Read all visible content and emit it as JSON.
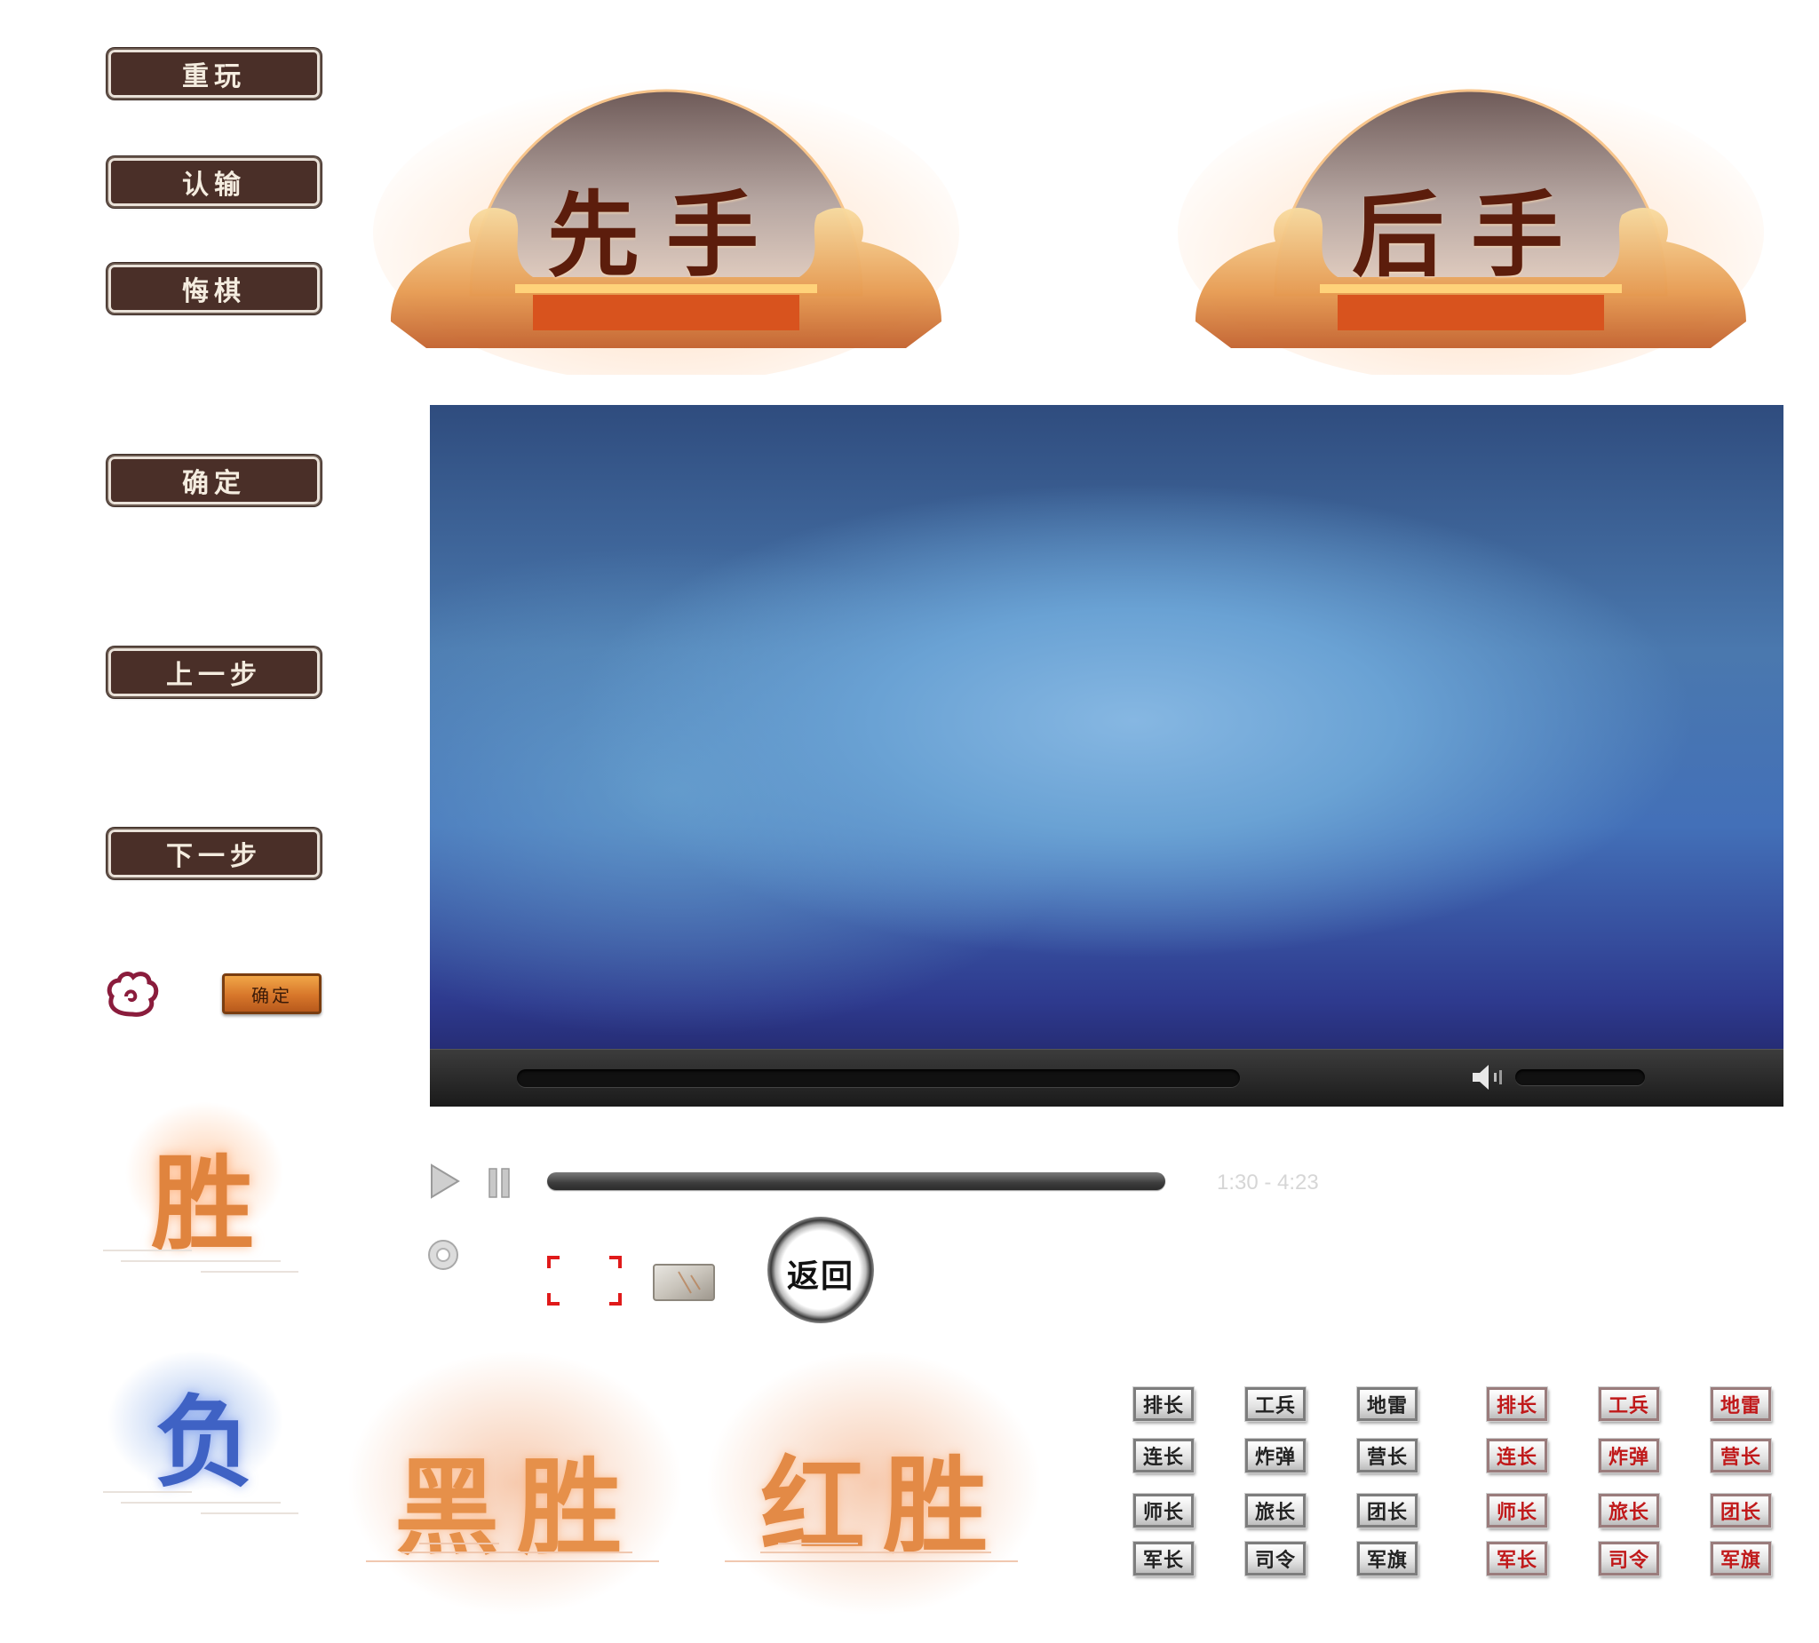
{
  "menu": {
    "replay": "重玩",
    "surrender": "认输",
    "undo": "悔棋",
    "confirm": "确定",
    "prev_step": "上一步",
    "next_step": "下一步"
  },
  "wood_confirm": "确定",
  "plaques": {
    "first": "先手",
    "second": "后手"
  },
  "player": {
    "timecode": "1:30 - 4:23",
    "progress": 1.0
  },
  "return_seal": "返回",
  "results": {
    "win": "胜",
    "lose": "负",
    "black_win": "黑胜",
    "red_win": "红胜"
  },
  "pieces": {
    "rows": [
      [
        "排长",
        "工兵",
        "地雷"
      ],
      [
        "连长",
        "炸弹",
        "营长"
      ],
      [
        "师长",
        "旅长",
        "团长"
      ],
      [
        "军长",
        "司令",
        "军旗"
      ]
    ],
    "gray_color": "#222222",
    "red_color": "#c0191a"
  }
}
